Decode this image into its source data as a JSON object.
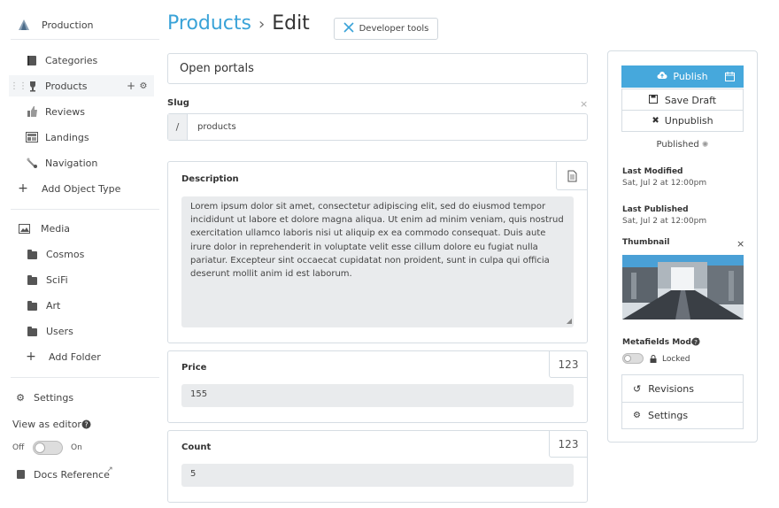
{
  "sidebar": {
    "app_title": "Production",
    "object_types": [
      {
        "label": "Categories",
        "icon": "book-icon"
      },
      {
        "label": "Products",
        "icon": "trophy-icon"
      },
      {
        "label": "Reviews",
        "icon": "thumbs-up-icon"
      },
      {
        "label": "Landings",
        "icon": "layout-icon"
      },
      {
        "label": "Navigation",
        "icon": "navigation-icon"
      }
    ],
    "add_object_type": "Add Object Type",
    "media_label": "Media",
    "folders": [
      "Cosmos",
      "SciFi",
      "Art",
      "Users"
    ],
    "add_folder": "Add Folder",
    "settings": "Settings",
    "view_as_editor": "View as editor",
    "toggle_off": "Off",
    "toggle_on": "On",
    "docs_reference": "Docs Reference"
  },
  "header": {
    "breadcrumb": "Products",
    "separator": "›",
    "current": "Edit",
    "dev_tools": "Developer tools"
  },
  "form": {
    "title_value": "Open portals",
    "slug_label": "Slug",
    "slug_prefix": "/",
    "slug_value": "products",
    "description_label": "Description",
    "description_value": "Lorem ipsum dolor sit amet, consectetur adipiscing elit, sed do eiusmod tempor incididunt ut labore et dolore magna aliqua. Ut enim ad minim veniam, quis nostrud exercitation ullamco laboris nisi ut aliquip ex ea commodo consequat. Duis aute irure dolor in reprehenderit in voluptate velit esse cillum dolore eu fugiat nulla pariatur. Excepteur sint occaecat cupidatat non proident, sunt in culpa qui officia deserunt mollit anim id est laborum.",
    "price_label": "Price",
    "price_value": "155",
    "count_label": "Count",
    "count_value": "5",
    "number_badge": "123"
  },
  "publish_panel": {
    "publish": "Publish",
    "save_draft": "Save Draft",
    "unpublish": "Unpublish",
    "status": "Published",
    "last_modified_label": "Last Modified",
    "last_modified_value": "Sat, Jul 2 at 12:00pm",
    "last_published_label": "Last Published",
    "last_published_value": "Sat, Jul 2 at 12:00pm",
    "thumbnail_label": "Thumbnail",
    "metafields_model": "Metafields Model",
    "locked": "Locked",
    "revisions": "Revisions",
    "settings": "Settings"
  },
  "colors": {
    "accent": "#3aa3d8",
    "publish_bg": "#46a8dc"
  }
}
